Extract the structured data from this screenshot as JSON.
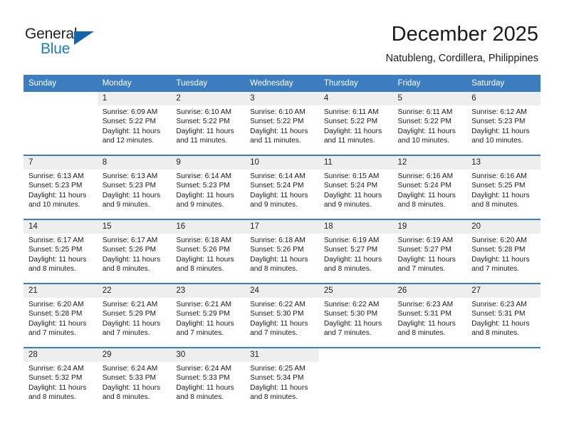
{
  "brand": {
    "name_part1": "General",
    "name_part2": "Blue",
    "flag_icon": "blue-triangle-flag-icon"
  },
  "header": {
    "title": "December 2025",
    "subtitle": "Natubleng, Cordillera, Philippines"
  },
  "colors": {
    "header_blue": "#3b7dbf",
    "brand_blue": "#1a7fc1",
    "flag_blue": "#1565a8",
    "daynum_band": "#eeeeee",
    "text": "#1a1a1a"
  },
  "weekday_headers": [
    "Sunday",
    "Monday",
    "Tuesday",
    "Wednesday",
    "Thursday",
    "Friday",
    "Saturday"
  ],
  "weeks": [
    [
      {
        "day": "",
        "sunrise": "",
        "sunset": "",
        "daylight_line1": "",
        "daylight_line2": "",
        "empty": true
      },
      {
        "day": "1",
        "sunrise": "Sunrise: 6:09 AM",
        "sunset": "Sunset: 5:22 PM",
        "daylight_line1": "Daylight: 11 hours",
        "daylight_line2": "and 12 minutes."
      },
      {
        "day": "2",
        "sunrise": "Sunrise: 6:10 AM",
        "sunset": "Sunset: 5:22 PM",
        "daylight_line1": "Daylight: 11 hours",
        "daylight_line2": "and 11 minutes."
      },
      {
        "day": "3",
        "sunrise": "Sunrise: 6:10 AM",
        "sunset": "Sunset: 5:22 PM",
        "daylight_line1": "Daylight: 11 hours",
        "daylight_line2": "and 11 minutes."
      },
      {
        "day": "4",
        "sunrise": "Sunrise: 6:11 AM",
        "sunset": "Sunset: 5:22 PM",
        "daylight_line1": "Daylight: 11 hours",
        "daylight_line2": "and 11 minutes."
      },
      {
        "day": "5",
        "sunrise": "Sunrise: 6:11 AM",
        "sunset": "Sunset: 5:22 PM",
        "daylight_line1": "Daylight: 11 hours",
        "daylight_line2": "and 10 minutes."
      },
      {
        "day": "6",
        "sunrise": "Sunrise: 6:12 AM",
        "sunset": "Sunset: 5:23 PM",
        "daylight_line1": "Daylight: 11 hours",
        "daylight_line2": "and 10 minutes."
      }
    ],
    [
      {
        "day": "7",
        "sunrise": "Sunrise: 6:13 AM",
        "sunset": "Sunset: 5:23 PM",
        "daylight_line1": "Daylight: 11 hours",
        "daylight_line2": "and 10 minutes."
      },
      {
        "day": "8",
        "sunrise": "Sunrise: 6:13 AM",
        "sunset": "Sunset: 5:23 PM",
        "daylight_line1": "Daylight: 11 hours",
        "daylight_line2": "and 9 minutes."
      },
      {
        "day": "9",
        "sunrise": "Sunrise: 6:14 AM",
        "sunset": "Sunset: 5:23 PM",
        "daylight_line1": "Daylight: 11 hours",
        "daylight_line2": "and 9 minutes."
      },
      {
        "day": "10",
        "sunrise": "Sunrise: 6:14 AM",
        "sunset": "Sunset: 5:24 PM",
        "daylight_line1": "Daylight: 11 hours",
        "daylight_line2": "and 9 minutes."
      },
      {
        "day": "11",
        "sunrise": "Sunrise: 6:15 AM",
        "sunset": "Sunset: 5:24 PM",
        "daylight_line1": "Daylight: 11 hours",
        "daylight_line2": "and 9 minutes."
      },
      {
        "day": "12",
        "sunrise": "Sunrise: 6:16 AM",
        "sunset": "Sunset: 5:24 PM",
        "daylight_line1": "Daylight: 11 hours",
        "daylight_line2": "and 8 minutes."
      },
      {
        "day": "13",
        "sunrise": "Sunrise: 6:16 AM",
        "sunset": "Sunset: 5:25 PM",
        "daylight_line1": "Daylight: 11 hours",
        "daylight_line2": "and 8 minutes."
      }
    ],
    [
      {
        "day": "14",
        "sunrise": "Sunrise: 6:17 AM",
        "sunset": "Sunset: 5:25 PM",
        "daylight_line1": "Daylight: 11 hours",
        "daylight_line2": "and 8 minutes."
      },
      {
        "day": "15",
        "sunrise": "Sunrise: 6:17 AM",
        "sunset": "Sunset: 5:26 PM",
        "daylight_line1": "Daylight: 11 hours",
        "daylight_line2": "and 8 minutes."
      },
      {
        "day": "16",
        "sunrise": "Sunrise: 6:18 AM",
        "sunset": "Sunset: 5:26 PM",
        "daylight_line1": "Daylight: 11 hours",
        "daylight_line2": "and 8 minutes."
      },
      {
        "day": "17",
        "sunrise": "Sunrise: 6:18 AM",
        "sunset": "Sunset: 5:26 PM",
        "daylight_line1": "Daylight: 11 hours",
        "daylight_line2": "and 8 minutes."
      },
      {
        "day": "18",
        "sunrise": "Sunrise: 6:19 AM",
        "sunset": "Sunset: 5:27 PM",
        "daylight_line1": "Daylight: 11 hours",
        "daylight_line2": "and 8 minutes."
      },
      {
        "day": "19",
        "sunrise": "Sunrise: 6:19 AM",
        "sunset": "Sunset: 5:27 PM",
        "daylight_line1": "Daylight: 11 hours",
        "daylight_line2": "and 7 minutes."
      },
      {
        "day": "20",
        "sunrise": "Sunrise: 6:20 AM",
        "sunset": "Sunset: 5:28 PM",
        "daylight_line1": "Daylight: 11 hours",
        "daylight_line2": "and 7 minutes."
      }
    ],
    [
      {
        "day": "21",
        "sunrise": "Sunrise: 6:20 AM",
        "sunset": "Sunset: 5:28 PM",
        "daylight_line1": "Daylight: 11 hours",
        "daylight_line2": "and 7 minutes."
      },
      {
        "day": "22",
        "sunrise": "Sunrise: 6:21 AM",
        "sunset": "Sunset: 5:29 PM",
        "daylight_line1": "Daylight: 11 hours",
        "daylight_line2": "and 7 minutes."
      },
      {
        "day": "23",
        "sunrise": "Sunrise: 6:21 AM",
        "sunset": "Sunset: 5:29 PM",
        "daylight_line1": "Daylight: 11 hours",
        "daylight_line2": "and 7 minutes."
      },
      {
        "day": "24",
        "sunrise": "Sunrise: 6:22 AM",
        "sunset": "Sunset: 5:30 PM",
        "daylight_line1": "Daylight: 11 hours",
        "daylight_line2": "and 7 minutes."
      },
      {
        "day": "25",
        "sunrise": "Sunrise: 6:22 AM",
        "sunset": "Sunset: 5:30 PM",
        "daylight_line1": "Daylight: 11 hours",
        "daylight_line2": "and 7 minutes."
      },
      {
        "day": "26",
        "sunrise": "Sunrise: 6:23 AM",
        "sunset": "Sunset: 5:31 PM",
        "daylight_line1": "Daylight: 11 hours",
        "daylight_line2": "and 8 minutes."
      },
      {
        "day": "27",
        "sunrise": "Sunrise: 6:23 AM",
        "sunset": "Sunset: 5:31 PM",
        "daylight_line1": "Daylight: 11 hours",
        "daylight_line2": "and 8 minutes."
      }
    ],
    [
      {
        "day": "28",
        "sunrise": "Sunrise: 6:24 AM",
        "sunset": "Sunset: 5:32 PM",
        "daylight_line1": "Daylight: 11 hours",
        "daylight_line2": "and 8 minutes."
      },
      {
        "day": "29",
        "sunrise": "Sunrise: 6:24 AM",
        "sunset": "Sunset: 5:33 PM",
        "daylight_line1": "Daylight: 11 hours",
        "daylight_line2": "and 8 minutes."
      },
      {
        "day": "30",
        "sunrise": "Sunrise: 6:24 AM",
        "sunset": "Sunset: 5:33 PM",
        "daylight_line1": "Daylight: 11 hours",
        "daylight_line2": "and 8 minutes."
      },
      {
        "day": "31",
        "sunrise": "Sunrise: 6:25 AM",
        "sunset": "Sunset: 5:34 PM",
        "daylight_line1": "Daylight: 11 hours",
        "daylight_line2": "and 8 minutes."
      },
      {
        "day": "",
        "sunrise": "",
        "sunset": "",
        "daylight_line1": "",
        "daylight_line2": "",
        "empty": true
      },
      {
        "day": "",
        "sunrise": "",
        "sunset": "",
        "daylight_line1": "",
        "daylight_line2": "",
        "empty": true
      },
      {
        "day": "",
        "sunrise": "",
        "sunset": "",
        "daylight_line1": "",
        "daylight_line2": "",
        "empty": true
      }
    ]
  ]
}
